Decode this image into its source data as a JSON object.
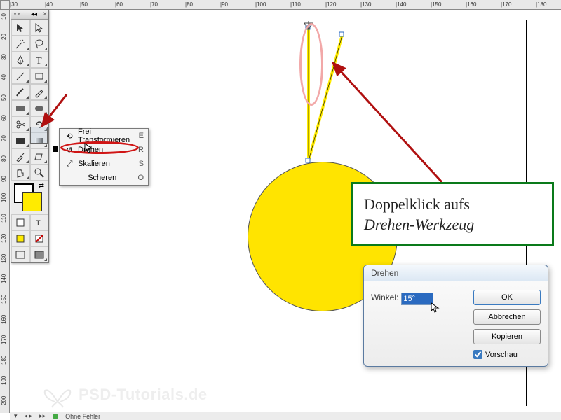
{
  "ruler_h": [
    "|30",
    "|40",
    "|50",
    "|60",
    "|70",
    "|80",
    "|90",
    "|100",
    "|110"
  ],
  "ruler_v": [
    "10",
    "20",
    "30",
    "40",
    "50",
    "60",
    "70",
    "80",
    "90",
    "100",
    "110",
    "120",
    "130",
    "140",
    "150",
    "160",
    "170",
    "180",
    "190",
    "200"
  ],
  "flyout": {
    "items": [
      {
        "icon": "⟲",
        "label": "Frei Transformieren",
        "key": "E"
      },
      {
        "icon": "↺",
        "label": "Drehen",
        "key": "R"
      },
      {
        "icon": "⤡",
        "label": "Skalieren",
        "key": "S"
      },
      {
        "icon": "",
        "label": "Scheren",
        "key": "O"
      }
    ]
  },
  "callout": {
    "line1": "Doppelklick aufs",
    "line2": "Drehen-Werkzeug"
  },
  "dialog": {
    "title": "Drehen",
    "angle_label": "Winkel:",
    "angle_value": "15°",
    "ok": "OK",
    "cancel": "Abbrechen",
    "copy": "Kopieren",
    "preview": "Vorschau",
    "preview_checked": true
  },
  "status": {
    "text": "Ohne Fehler"
  },
  "watermark": "PSD-Tutorials.de"
}
